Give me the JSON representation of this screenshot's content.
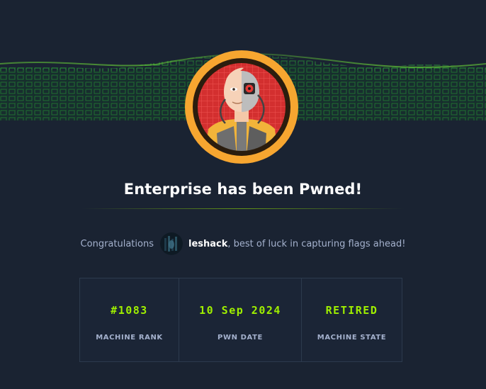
{
  "title": "Enterprise has been Pwned!",
  "congrats": {
    "prefix": "Congratulations",
    "username": "leshack",
    "suffix": ", best of luck in capturing flags ahead!"
  },
  "stats": [
    {
      "value": "#1083",
      "label": "MACHINE RANK"
    },
    {
      "value": "10 Sep 2024",
      "label": "PWN DATE"
    },
    {
      "value": "RETIRED",
      "label": "MACHINE STATE"
    }
  ],
  "colors": {
    "background": "#1a2332",
    "accent": "#9fef00",
    "badge_ring": "#f7a630",
    "muted_text": "#a4b1cd"
  },
  "icons": {
    "banner": "green-cube-grid-wave",
    "badge": "cyborg-avatar-badge",
    "user_avatar": "user-avatar"
  }
}
